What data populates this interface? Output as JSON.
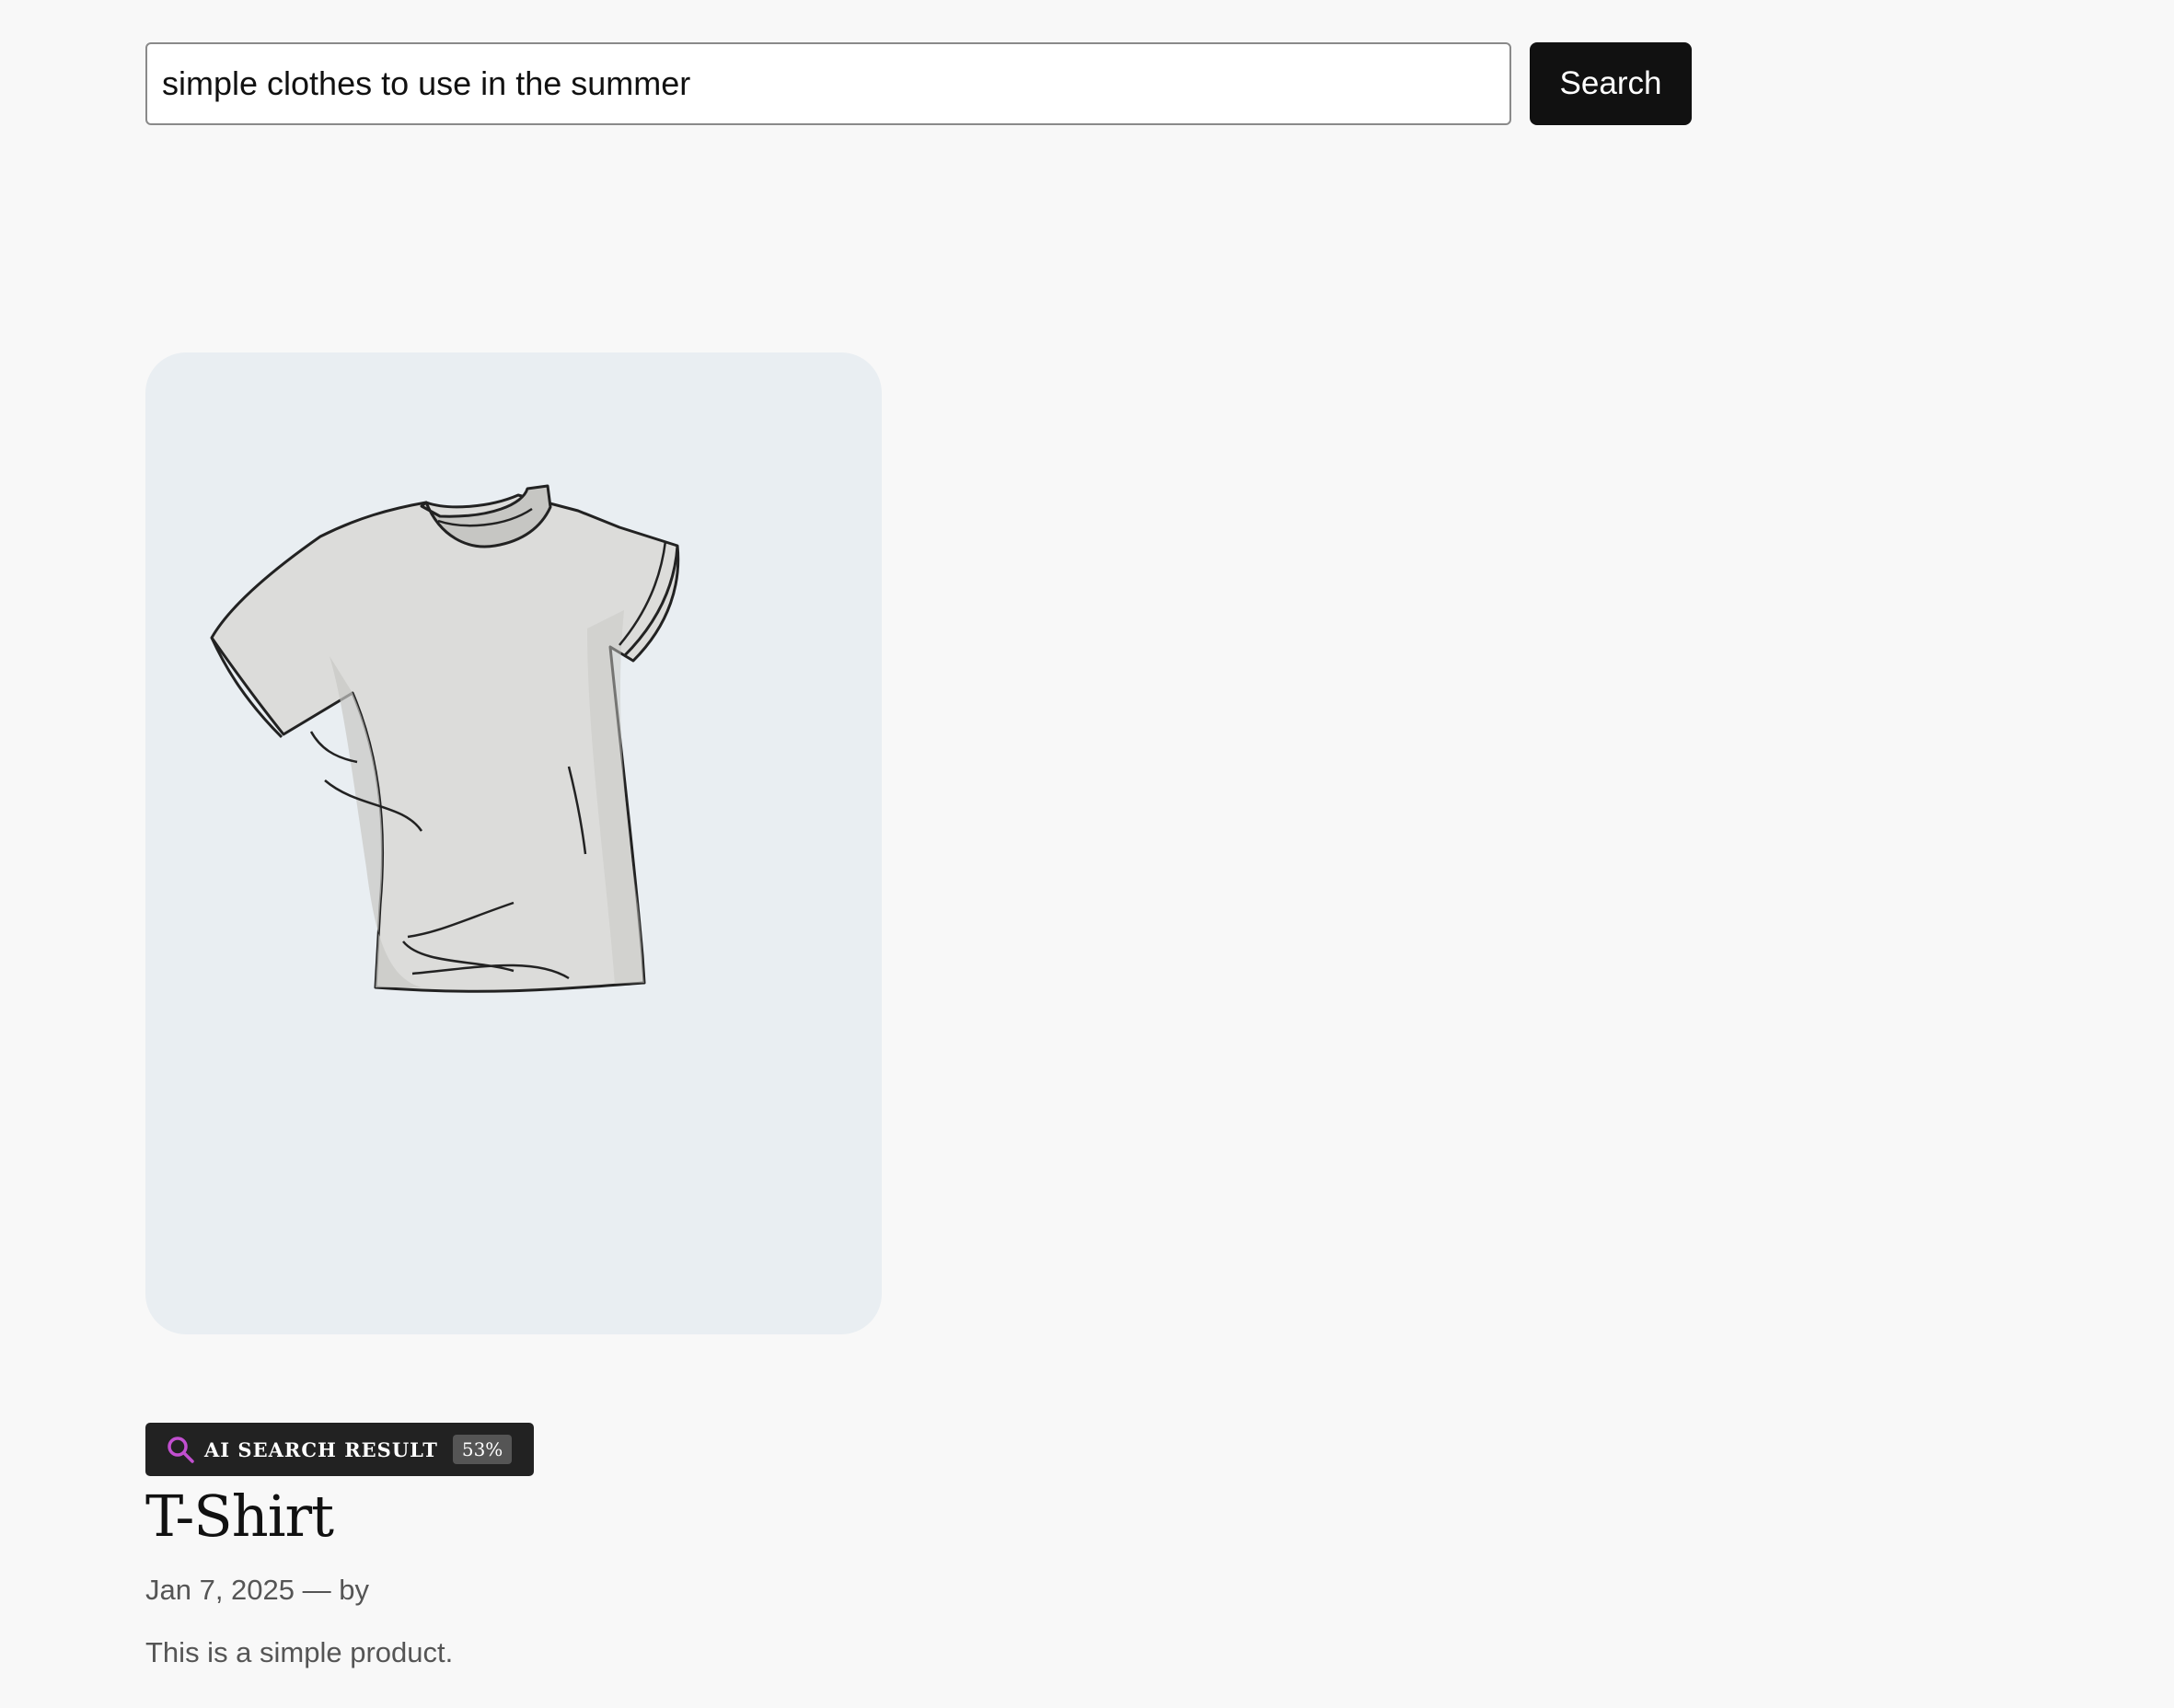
{
  "search": {
    "value": "simple clothes to use in the summer",
    "button_label": "Search"
  },
  "result": {
    "badge_icon": "search-icon",
    "badge_label": "AI SEARCH RESULT",
    "badge_score": "53%",
    "title": "T-Shirt",
    "date": "Jan 7, 2025",
    "separator": "—",
    "by_label": "by",
    "description": "This is a simple product.",
    "image_subject": "t-shirt-illustration"
  },
  "colors": {
    "page_background": "#f8f8f8",
    "button_background": "#111111",
    "image_background": "#e9eef2",
    "badge_background": "#222222",
    "badge_icon_accent": "#c24fd0"
  }
}
